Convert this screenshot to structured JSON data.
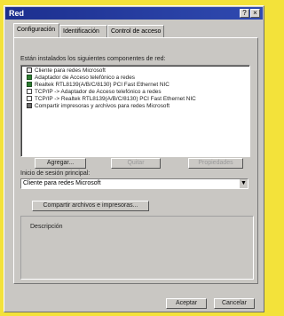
{
  "window": {
    "title": "Red",
    "help_glyph": "?",
    "close_glyph": "×"
  },
  "tabs": [
    {
      "label": "Configuración"
    },
    {
      "label": "Identificación"
    },
    {
      "label": "Control de acceso"
    }
  ],
  "components": {
    "label": "Están instalados los siguientes componentes de red:",
    "items": [
      {
        "label": "Cliente para redes Microsoft",
        "icon": "client-icon"
      },
      {
        "label": "Adaptador de Acceso telefónico a redes",
        "icon": "adapter-icon"
      },
      {
        "label": "Realtek RTL8139(A/B/C/8130) PCI Fast Ethernet NIC",
        "icon": "adapter-icon"
      },
      {
        "label": "TCP/IP -> Adaptador de Acceso telefónico a redes",
        "icon": "protocol-icon"
      },
      {
        "label": "TCP/IP -> Realtek RTL8139(A/B/C/8130) PCI Fast Ethernet NIC",
        "icon": "protocol-icon"
      },
      {
        "label": "Compartir impresoras y archivos para redes Microsoft",
        "icon": "service-icon"
      }
    ]
  },
  "actions": {
    "add": "Agregar...",
    "remove": "Quitar",
    "properties": "Propiedades"
  },
  "primary_logon": {
    "label": "Inicio de sesión principal:",
    "value": "Cliente para redes Microsoft"
  },
  "sharing_button": "Compartir archivos e impresoras...",
  "description_label": "Descripción",
  "footer": {
    "ok": "Aceptar",
    "cancel": "Cancelar"
  }
}
